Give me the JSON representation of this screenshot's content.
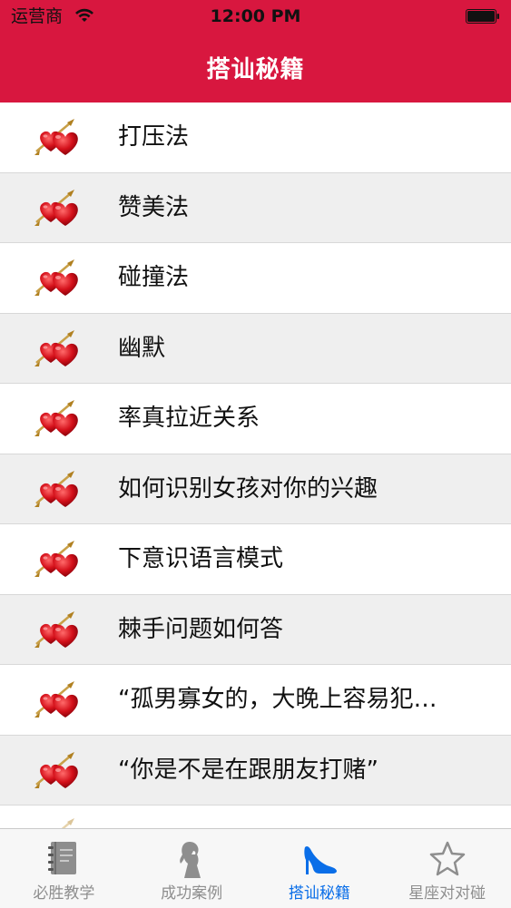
{
  "status_bar": {
    "carrier": "运营商",
    "time": "12:00 PM"
  },
  "navbar": {
    "title": "搭讪秘籍"
  },
  "list": {
    "items": [
      {
        "label": "打压法"
      },
      {
        "label": "赞美法"
      },
      {
        "label": "碰撞法"
      },
      {
        "label": "幽默"
      },
      {
        "label": "率真拉近关系"
      },
      {
        "label": "如何识别女孩对你的兴趣"
      },
      {
        "label": "下意识语言模式"
      },
      {
        "label": "棘手问题如何答"
      },
      {
        "label": "“孤男寡女的，大晚上容易犯…"
      },
      {
        "label": "“你是不是在跟朋友打赌”"
      }
    ]
  },
  "tab_bar": {
    "tabs": [
      {
        "label": "必胜教学",
        "icon": "notebook-icon",
        "active": false
      },
      {
        "label": "成功案例",
        "icon": "woman-silhouette-icon",
        "active": false
      },
      {
        "label": "搭讪秘籍",
        "icon": "high-heel-icon",
        "active": true
      },
      {
        "label": "星座对对碰",
        "icon": "star-icon",
        "active": false
      }
    ]
  },
  "colors": {
    "header": "#d8173f",
    "active_tab": "#0a6ee8",
    "inactive_tab": "#8e8e8e",
    "row_alt": "#efefef"
  }
}
